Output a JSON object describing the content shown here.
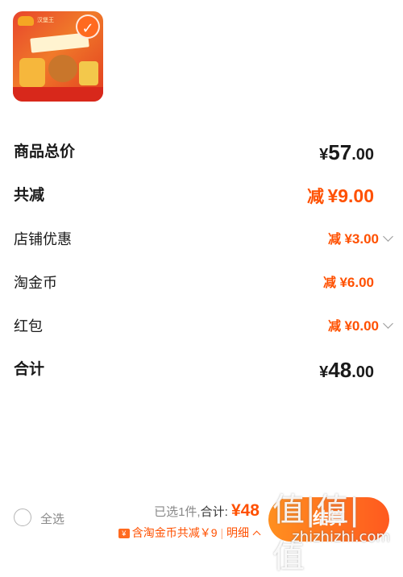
{
  "product": {
    "brand": "汉堡王",
    "selected": true
  },
  "summary": {
    "goods_total": {
      "label": "商品总价",
      "yen": "¥",
      "int": "57",
      "dec": ".00"
    },
    "total_discount": {
      "label": "共减",
      "prefix": "减",
      "amount": "¥9.00"
    },
    "shop_discount": {
      "label": "店铺优惠",
      "prefix": "减",
      "amount": "¥3.00"
    },
    "taojinbi": {
      "label": "淘金币",
      "prefix": "减",
      "amount": "¥6.00"
    },
    "red_packet": {
      "label": "红包",
      "prefix": "减",
      "amount": "¥0.00"
    },
    "grand_total": {
      "label": "合计",
      "yen": "¥",
      "int": "48",
      "dec": ".00"
    }
  },
  "bottom_bar": {
    "select_all": "全选",
    "selected_count_text": "已选1件,",
    "total_label": "合计:",
    "total_value": "¥48",
    "coin_icon": "¥",
    "coin_text": "含淘金币共减￥9",
    "coin_sep": "|",
    "detail_label": "明细",
    "checkout_label": "结算"
  },
  "watermark": {
    "logo": "值|值|值",
    "url": "zhizhizhi.com"
  },
  "colors": {
    "accent": "#ff5000",
    "checkout_start": "#ff8f1f",
    "checkout_end": "#ff5a1f"
  }
}
